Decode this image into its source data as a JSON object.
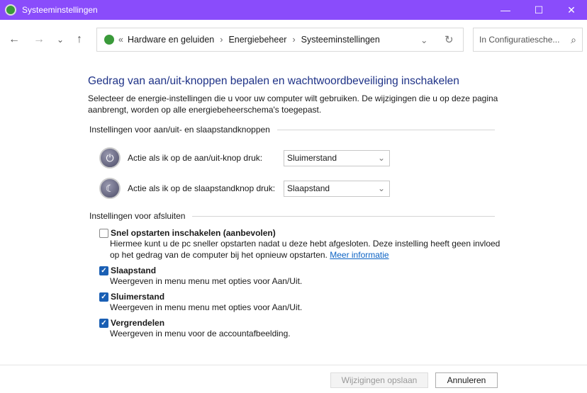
{
  "window": {
    "title": "Systeeminstellingen",
    "min": "—",
    "max": "☐",
    "close": "✕"
  },
  "nav": {
    "back": "←",
    "forward": "→",
    "recent": "⌄",
    "up": "↑"
  },
  "breadcrumb": {
    "prefix": "«",
    "items": [
      "Hardware en geluiden",
      "Energiebeheer",
      "Systeeminstellingen"
    ],
    "sep": "›",
    "dropdown": "⌄",
    "refresh": "↻"
  },
  "search": {
    "placeholder": "In Configuratiesche...",
    "icon": "⌕"
  },
  "page": {
    "title": "Gedrag van aan/uit-knoppen bepalen en wachtwoordbeveiliging inschakelen",
    "description": "Selecteer de energie-instellingen die u voor uw computer wilt gebruiken. De wijzigingen die u op deze pagina aanbrengt, worden op alle energiebeheerschema's toegepast."
  },
  "buttons_section": {
    "heading": "Instellingen voor aan/uit- en slaapstandknoppen",
    "rows": [
      {
        "label": "Actie als ik op de aan/uit-knop druk:",
        "value": "Sluimerstand",
        "icon": "⏻"
      },
      {
        "label": "Actie als ik op de slaapstandknop druk:",
        "value": "Slaapstand",
        "icon": "☾"
      }
    ]
  },
  "shutdown_section": {
    "heading": "Instellingen voor afsluiten",
    "items": [
      {
        "label": "Snel opstarten inschakelen (aanbevolen)",
        "checked": false,
        "desc": "Hiermee kunt u de pc sneller opstarten nadat u deze hebt afgesloten. Deze instelling heeft geen invloed op het gedrag van de computer bij het opnieuw opstarten.",
        "link": "Meer informatie"
      },
      {
        "label": "Slaapstand",
        "checked": true,
        "desc": "Weergeven in menu menu met opties voor Aan/Uit."
      },
      {
        "label": "Sluimerstand",
        "checked": true,
        "desc": "Weergeven in menu menu met opties voor Aan/Uit."
      },
      {
        "label": "Vergrendelen",
        "checked": true,
        "desc": "Weergeven in menu voor de accountafbeelding."
      }
    ]
  },
  "footer": {
    "save": "Wijzigingen opslaan",
    "cancel": "Annuleren"
  },
  "check_glyph": "✓"
}
